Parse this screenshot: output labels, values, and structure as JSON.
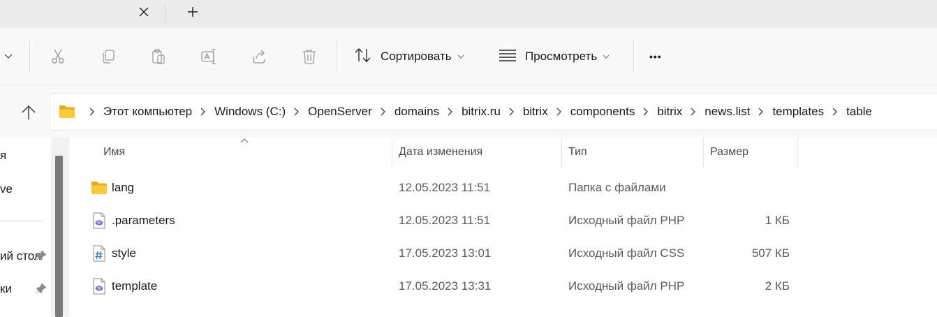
{
  "tabs": {
    "close_icon": "close-icon",
    "new_tab_icon": "plus-icon"
  },
  "toolbar": {
    "sort_label": "Сортировать",
    "view_label": "Просмотреть",
    "more_label": "•••",
    "icons": [
      "cut-icon",
      "copy-icon",
      "paste-icon",
      "rename-icon",
      "share-icon",
      "delete-icon"
    ]
  },
  "address": {
    "crumbs": [
      "Этот компьютер",
      "Windows (C:)",
      "OpenServer",
      "domains",
      "bitrix.ru",
      "bitrix",
      "components",
      "bitrix",
      "news.list",
      "templates",
      "table"
    ]
  },
  "nav": {
    "items": [
      "я",
      "ve",
      "ий стол",
      "ки"
    ]
  },
  "files": {
    "columns": {
      "name": "Имя",
      "date": "Дата изменения",
      "type": "Тип",
      "size": "Размер"
    },
    "rows": [
      {
        "icon": "folder-icon",
        "name": "lang",
        "date": "12.05.2023 11:51",
        "type": "Папка с файлами",
        "size": ""
      },
      {
        "icon": "php-file-icon",
        "name": ".parameters",
        "date": "12.05.2023 11:51",
        "type": "Исходный файл PHP",
        "size": "1 КБ"
      },
      {
        "icon": "css-file-icon",
        "name": "style",
        "date": "17.05.2023 13:01",
        "type": "Исходный файл CSS",
        "size": "507 КБ"
      },
      {
        "icon": "php-file-icon",
        "name": "template",
        "date": "17.05.2023 13:31",
        "type": "Исходный файл PHP",
        "size": "2 КБ"
      }
    ]
  },
  "colors": {
    "folder": "#f8c938",
    "folder_dark": "#e7a823",
    "php_badge": "#8a6fc9",
    "css_badge": "#3a7ab8",
    "chrome_bg": "#f9f9f9",
    "tab_bg": "#ececec"
  }
}
